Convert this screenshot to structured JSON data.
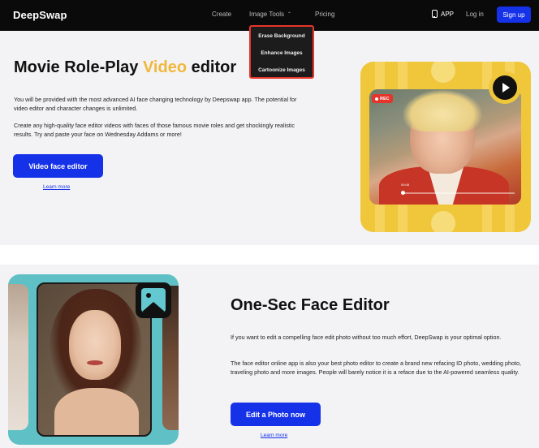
{
  "nav": {
    "logo": "DeepSwap",
    "links": [
      "Create",
      "Image Tools",
      "Pricing"
    ],
    "image_tools_caret": "⌃",
    "app_label": "APP",
    "login_label": "Log in",
    "signup_label": "Sign up"
  },
  "dropdown": {
    "items": [
      "Erase Background",
      "Enhance Images",
      "Cartoonize Images"
    ],
    "highlight_color": "#e8352a"
  },
  "hero": {
    "title_before": "Movie Role-Play ",
    "title_accent": "Video",
    "title_after": " editor",
    "accent_color": "#f1b73c",
    "paragraph1": "You will be provided with the most advanced AI face changing technology by Deepswap app. The potential for video editor and character changes is unlimited.",
    "paragraph2": "Create any high-quality face editor videos with faces of those famous movie roles and get shockingly realistic results. Try and paste your face on Wednesday Addams or more!",
    "button_label": "Video face editor",
    "learn_more": "Learn more",
    "video": {
      "rec_label": "REC",
      "time": "00:08",
      "card_color": "#f0c73a"
    }
  },
  "section2": {
    "title": "One-Sec Face Editor",
    "paragraph1": "If you want to edit a compelling face edit photo without too much effort, DeepSwap is your optimal option.",
    "paragraph2": "The face editor online app is also your best photo editor to create a brand new refacing ID photo, wedding photo, traveling photo and more images. People will barely notice it is a reface due to the AI-powered seamless quality.",
    "button_label": "Edit a Photo now",
    "learn_more": "Learn more",
    "card_color": "#5fc1c6"
  },
  "colors": {
    "brand_blue": "#1532e8",
    "nav_bg": "#0a0a0a",
    "section_bg": "#f3f3f5"
  }
}
